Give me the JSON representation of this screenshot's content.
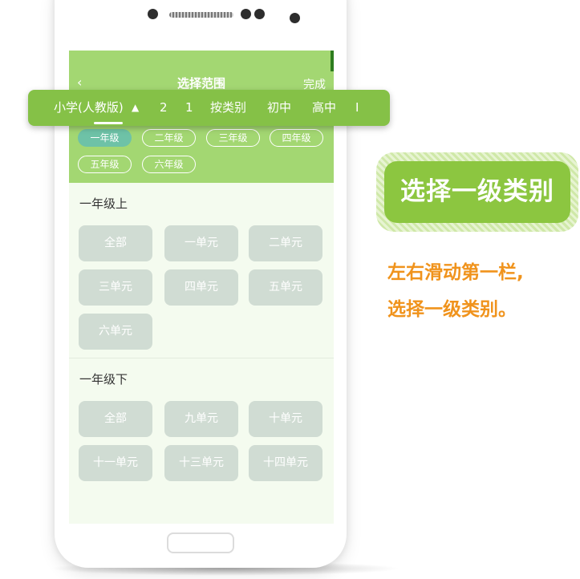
{
  "header": {
    "back_icon": "‹",
    "title": "选择范围",
    "done": "完成"
  },
  "category_bar": {
    "items": [
      "小学(人教版)",
      "2",
      "1",
      "按类别",
      "初中",
      "高中",
      "I"
    ],
    "selected_index": 0
  },
  "grades": {
    "items": [
      "一年级",
      "二年级",
      "三年级",
      "四年级",
      "五年级",
      "六年级"
    ],
    "active_index": 0
  },
  "sections": [
    {
      "title": "一年级上",
      "units": [
        "全部",
        "一单元",
        "二单元",
        "三单元",
        "四单元",
        "五单元",
        "六单元"
      ]
    },
    {
      "title": "一年级下",
      "units": [
        "全部",
        "九单元",
        "十单元",
        "十一单元",
        "十三单元",
        "十四单元"
      ]
    }
  ],
  "callout": {
    "badge": "选择一级类别",
    "line1": "左右滑动第一栏,",
    "line2": "选择一级类别。"
  },
  "colors": {
    "accent_green": "#85c147",
    "header_green": "#a3d772",
    "active_grade": "#6ec2a7",
    "orange": "#f0931c"
  }
}
